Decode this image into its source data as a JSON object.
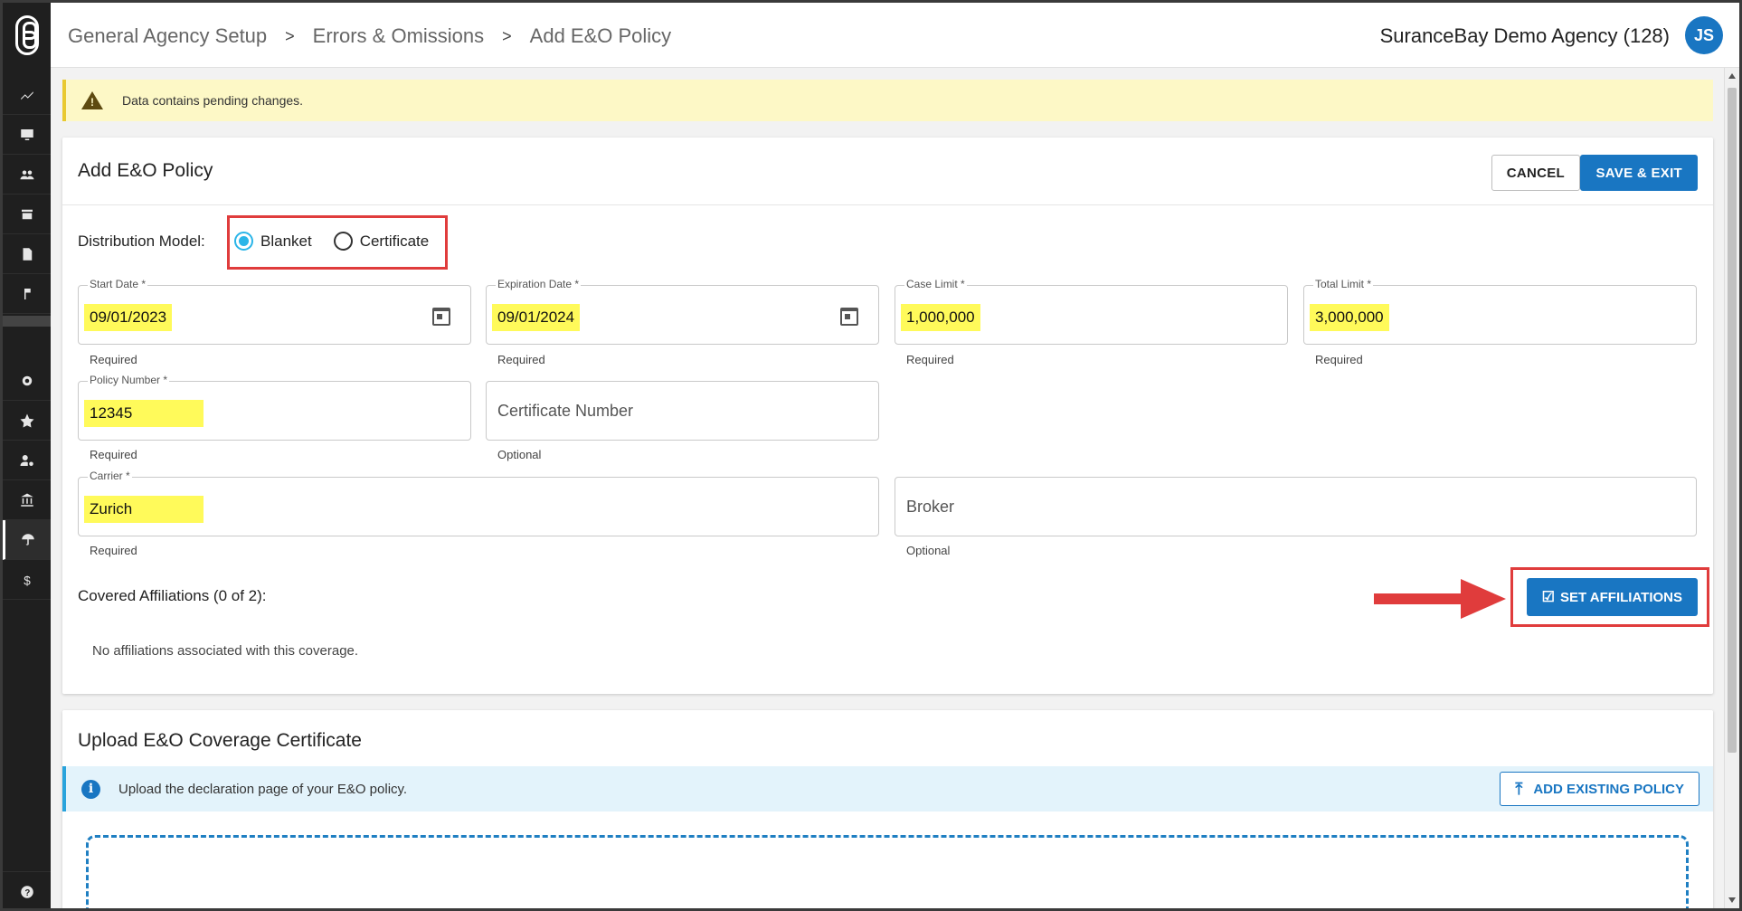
{
  "header": {
    "breadcrumbs": [
      "General Agency Setup",
      "Errors & Omissions",
      "Add E&O Policy"
    ],
    "separator": ">",
    "agency": "SuranceBay Demo Agency (128)",
    "avatar_initials": "JS"
  },
  "sidebar": {
    "items": [
      {
        "icon": "analytics-icon"
      },
      {
        "icon": "monitor-icon"
      },
      {
        "icon": "people-icon"
      },
      {
        "icon": "store-icon"
      },
      {
        "icon": "document-icon"
      },
      {
        "icon": "flag-icon"
      },
      {
        "icon": "gear-icon"
      },
      {
        "icon": "badge-icon"
      },
      {
        "icon": "user-settings-icon"
      },
      {
        "icon": "bank-icon"
      },
      {
        "icon": "umbrella-icon",
        "active": true
      },
      {
        "icon": "dollar-icon"
      },
      {
        "icon": "help-icon"
      }
    ]
  },
  "alert": {
    "text": "Data contains pending changes."
  },
  "policy_card": {
    "title": "Add E&O Policy",
    "cancel_label": "CANCEL",
    "save_label": "SAVE & EXIT",
    "distribution_label": "Distribution Model:",
    "distribution_options": [
      "Blanket",
      "Certificate"
    ],
    "distribution_selected": "Blanket",
    "fields": {
      "start_date": {
        "label": "Start Date *",
        "value": "09/01/2023",
        "helper": "Required"
      },
      "expiration_date": {
        "label": "Expiration Date *",
        "value": "09/01/2024",
        "helper": "Required"
      },
      "case_limit": {
        "label": "Case Limit *",
        "value": "1,000,000",
        "helper": "Required"
      },
      "total_limit": {
        "label": "Total Limit *",
        "value": "3,000,000",
        "helper": "Required"
      },
      "policy_number": {
        "label": "Policy Number *",
        "value": "12345",
        "helper": "Required"
      },
      "certificate_number": {
        "placeholder": "Certificate Number",
        "helper": "Optional"
      },
      "carrier": {
        "label": "Carrier *",
        "value": "Zurich",
        "helper": "Required"
      },
      "broker": {
        "placeholder": "Broker",
        "helper": "Optional"
      }
    },
    "covered_label": "Covered Affiliations (0 of 2):",
    "no_affiliations": "No affiliations associated with this coverage.",
    "set_affiliations_label": "SET AFFILIATIONS"
  },
  "upload_card": {
    "title": "Upload E&O Coverage Certificate",
    "info_text": "Upload the declaration page of your E&O policy.",
    "add_existing_label": "ADD EXISTING POLICY"
  },
  "colors": {
    "primary": "#1976c2",
    "highlight": "#fffa5a",
    "annotation": "#e03c3c",
    "radio": "#2ab5e8"
  }
}
